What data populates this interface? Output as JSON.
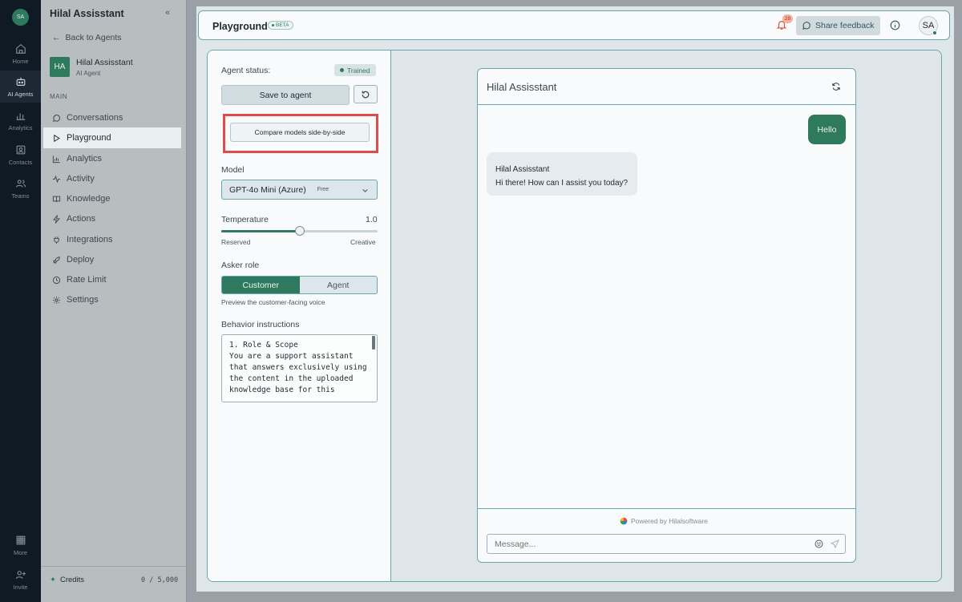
{
  "rail": {
    "avatar": "SA",
    "items": [
      {
        "label": "Home",
        "icon": "home-icon"
      },
      {
        "label": "AI Agents",
        "icon": "robot-icon"
      },
      {
        "label": "Analytics",
        "icon": "bar-chart-icon"
      },
      {
        "label": "Contacts",
        "icon": "contact-card-icon"
      },
      {
        "label": "Teams",
        "icon": "people-icon"
      },
      {
        "label": "More",
        "icon": "grid-icon"
      },
      {
        "label": "Invite",
        "icon": "user-plus-icon"
      }
    ]
  },
  "sidebar": {
    "title": "Hilal Assisstant",
    "back_label": "Back to Agents",
    "agent_initials": "HA",
    "agent_name": "Hilal Assisstant",
    "agent_sub": "AI Agent",
    "section_label": "MAIN",
    "items": [
      {
        "label": "Conversations"
      },
      {
        "label": "Playground"
      },
      {
        "label": "Analytics"
      },
      {
        "label": "Activity"
      },
      {
        "label": "Knowledge"
      },
      {
        "label": "Actions"
      },
      {
        "label": "Integrations"
      },
      {
        "label": "Deploy"
      },
      {
        "label": "Rate Limit"
      },
      {
        "label": "Settings"
      }
    ],
    "credits_label": "Credits",
    "credits_value": "0 / 5,000"
  },
  "header": {
    "title": "Playground",
    "badge": "BETA",
    "notification_count": "28",
    "share_label": "Share feedback",
    "user_initials": "SA"
  },
  "settings": {
    "status_label": "Agent status:",
    "status_value": "Trained",
    "save_label": "Save to agent",
    "compare_label": "Compare models side-by-side",
    "model_label": "Model",
    "model_value": "GPT-4o Mini (Azure)",
    "model_tier": "Free",
    "temperature_label": "Temperature",
    "temperature_value": "1.0",
    "temperature_fraction": 0.5,
    "temp_min_label": "Reserved",
    "temp_max_label": "Creative",
    "asker_label": "Asker role",
    "asker_options": [
      "Customer",
      "Agent"
    ],
    "asker_selected": "Customer",
    "asker_hint": "Preview the customer-facing voice",
    "behavior_label": "Behavior instructions",
    "behavior_text": "1. Role & Scope\nYou are a support assistant that answers exclusively using the content in the uploaded knowledge base for this"
  },
  "chat": {
    "title": "Hilal Assisstant",
    "user_message": "Hello",
    "bot_name": "Hilal Assisstant",
    "bot_message": "Hi there! How can I assist you today?",
    "powered_by": "Powered by Hilalsoftware",
    "input_placeholder": "Message..."
  },
  "colors": {
    "accent": "#2f7a5e",
    "outline": "#6aa7ad",
    "highlight": "#e04a4a"
  }
}
